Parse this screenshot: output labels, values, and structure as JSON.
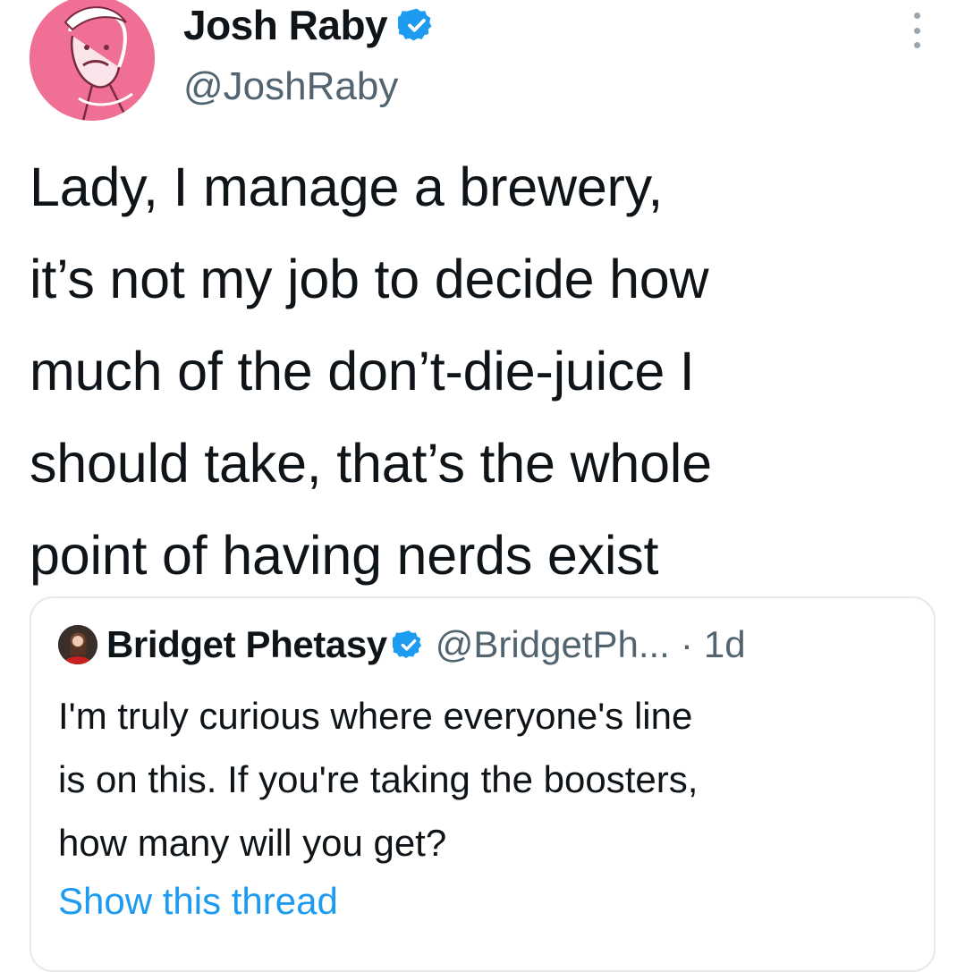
{
  "tweet": {
    "author": {
      "display_name": "Josh Raby",
      "handle": "@JoshRaby",
      "verified": true,
      "avatar_icon": "illustrated-portrait-avatar",
      "avatar_bg": "#f06f95"
    },
    "text": "Lady, I manage a brewery,\nit’s not my job to decide how\nmuch of the don’t-die-juice I\nshould take, that’s the whole\npoint of having nerds exist",
    "more_icon": "vertical-ellipsis-icon"
  },
  "quote": {
    "author": {
      "display_name": "Bridget Phetasy",
      "handle": "@BridgetPh...",
      "verified": true
    },
    "separator": "·",
    "time": "1d",
    "text": "I'm truly curious where everyone's line\nis on this. If you're taking the boosters,\nhow many will you get?",
    "show_thread": "Show this thread"
  },
  "colors": {
    "verified": "#1d9bf0",
    "link": "#1d9bf0",
    "secondary_text": "#536471",
    "border": "#e6e8ea"
  }
}
